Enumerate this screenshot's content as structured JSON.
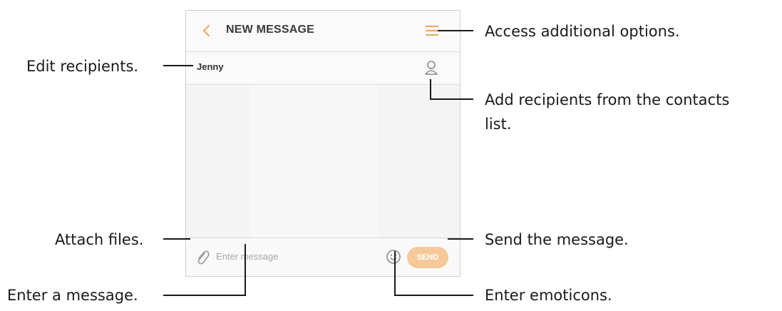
{
  "header": {
    "title": "NEW MESSAGE"
  },
  "recipient": {
    "name": "Jenny"
  },
  "composer": {
    "placeholder": "Enter message",
    "send_label": "SEND"
  },
  "callouts": {
    "options": "Access additional options.",
    "edit_recipients": "Edit recipients.",
    "add_recipients_line1": "Add recipients from the contacts",
    "add_recipients_line2": "list.",
    "attach_files": "Attach files.",
    "send": "Send the message.",
    "enter_message": "Enter a message.",
    "emoticons": "Enter emoticons."
  },
  "colors": {
    "accent": "#f0a868",
    "send_bg": "#f6c99a",
    "callout_text": "#1a1a1a"
  },
  "icons": [
    "back-arrow",
    "menu",
    "contact",
    "paperclip",
    "emoticon"
  ]
}
